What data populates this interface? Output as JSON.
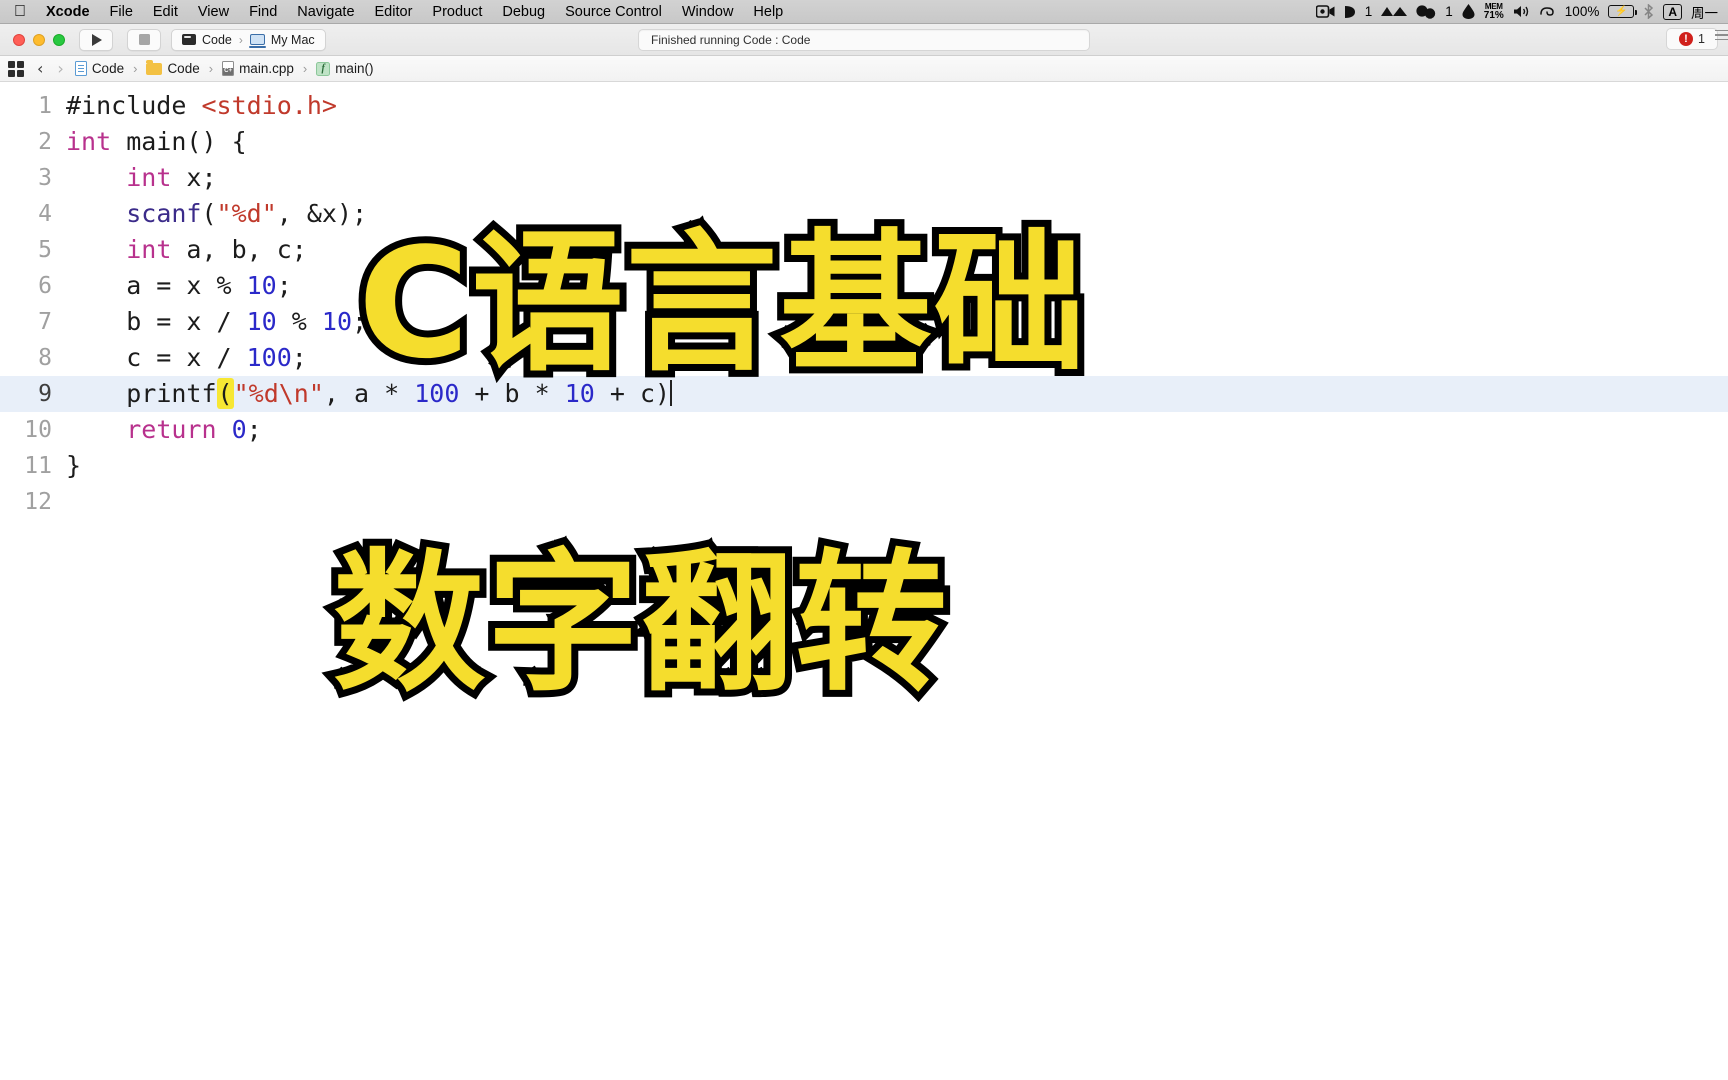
{
  "menubar": {
    "apple_icon": "apple-logo",
    "items": [
      {
        "label": "Xcode",
        "bold": true
      },
      {
        "label": "File",
        "bold": false
      },
      {
        "label": "Edit",
        "bold": false
      },
      {
        "label": "View",
        "bold": false
      },
      {
        "label": "Find",
        "bold": false
      },
      {
        "label": "Navigate",
        "bold": false
      },
      {
        "label": "Editor",
        "bold": false
      },
      {
        "label": "Product",
        "bold": false
      },
      {
        "label": "Debug",
        "bold": false
      },
      {
        "label": "Source Control",
        "bold": false
      },
      {
        "label": "Window",
        "bold": false
      },
      {
        "label": "Help",
        "bold": false
      }
    ],
    "status_icons": {
      "screen_record": "▣",
      "cleanmymac_count": "1",
      "mountain_icon": "▲▲",
      "bubbles_count": "1",
      "mem_label": "MEM",
      "mem_value": "71%",
      "volume_icon": "speaker-icon",
      "control_center_icon": "control-center-icon",
      "battery_percent": "100%",
      "battery_charging": true,
      "bluetooth_icon": "bluetooth-icon",
      "input_source": "A",
      "date_text": "周一"
    }
  },
  "toolbar": {
    "run_button": "run-button",
    "stop_button": "stop-button",
    "scheme_name": "Code",
    "destination_name": "My Mac",
    "status_text": "Finished running Code : Code",
    "error_glyph": "!",
    "issue_count": "1"
  },
  "jumpbar": {
    "crumbs": [
      {
        "label": "Code",
        "icon": "project-icon"
      },
      {
        "label": "Code",
        "icon": "folder-icon"
      },
      {
        "label": "main.cpp",
        "icon": "cpp-file-icon"
      },
      {
        "label": "main()",
        "icon": "function-icon"
      }
    ],
    "back_arrow": "‹",
    "forward_arrow": "›"
  },
  "editor": {
    "active_line": 9,
    "lines": [
      {
        "n": "1",
        "tokens": [
          {
            "t": "#include ",
            "c": "tk-pre"
          },
          {
            "t": "<stdio.h>",
            "c": "tk-hdr"
          }
        ]
      },
      {
        "n": "2",
        "tokens": [
          {
            "t": "int",
            "c": "tk-kw"
          },
          {
            "t": " main() {",
            "c": "tk-plain"
          }
        ]
      },
      {
        "n": "3",
        "tokens": [
          {
            "t": "    ",
            "c": "tk-plain"
          },
          {
            "t": "int",
            "c": "tk-kw"
          },
          {
            "t": " x;",
            "c": "tk-plain"
          }
        ]
      },
      {
        "n": "4",
        "tokens": [
          {
            "t": "    ",
            "c": "tk-plain"
          },
          {
            "t": "scanf",
            "c": "tk-fn"
          },
          {
            "t": "(",
            "c": "tk-plain"
          },
          {
            "t": "\"%d\"",
            "c": "tk-str"
          },
          {
            "t": ", &x);",
            "c": "tk-plain"
          }
        ]
      },
      {
        "n": "5",
        "tokens": [
          {
            "t": "    ",
            "c": "tk-plain"
          },
          {
            "t": "int",
            "c": "tk-kw"
          },
          {
            "t": " a, b, c;",
            "c": "tk-plain"
          }
        ]
      },
      {
        "n": "6",
        "tokens": [
          {
            "t": "    a = x % ",
            "c": "tk-plain"
          },
          {
            "t": "10",
            "c": "tk-num"
          },
          {
            "t": ";",
            "c": "tk-plain"
          }
        ]
      },
      {
        "n": "7",
        "tokens": [
          {
            "t": "    b = x / ",
            "c": "tk-plain"
          },
          {
            "t": "10",
            "c": "tk-num"
          },
          {
            "t": " % ",
            "c": "tk-plain"
          },
          {
            "t": "10",
            "c": "tk-num"
          },
          {
            "t": ";",
            "c": "tk-plain"
          }
        ]
      },
      {
        "n": "8",
        "tokens": [
          {
            "t": "    c = x / ",
            "c": "tk-plain"
          },
          {
            "t": "100",
            "c": "tk-num"
          },
          {
            "t": ";",
            "c": "tk-plain"
          }
        ]
      },
      {
        "n": "9",
        "tokens": [
          {
            "t": "    ",
            "c": "tk-plain"
          },
          {
            "t": "printf",
            "c": "tk-plain"
          },
          {
            "t": "(",
            "c": "hl-paren"
          },
          {
            "t": "\"%d\\n\"",
            "c": "tk-str"
          },
          {
            "t": ", a * ",
            "c": "tk-plain"
          },
          {
            "t": "100",
            "c": "tk-num"
          },
          {
            "t": " + b * ",
            "c": "tk-plain"
          },
          {
            "t": "10",
            "c": "tk-num"
          },
          {
            "t": " + c)",
            "c": "tk-plain"
          }
        ],
        "caret": true
      },
      {
        "n": "10",
        "tokens": [
          {
            "t": "    ",
            "c": "tk-plain"
          },
          {
            "t": "return",
            "c": "tk-kw"
          },
          {
            "t": " ",
            "c": "tk-plain"
          },
          {
            "t": "0",
            "c": "tk-num"
          },
          {
            "t": ";",
            "c": "tk-plain"
          }
        ]
      },
      {
        "n": "11",
        "tokens": [
          {
            "t": "}",
            "c": "tk-plain"
          }
        ]
      },
      {
        "n": "12",
        "tokens": [
          {
            "t": "",
            "c": "tk-plain"
          }
        ]
      }
    ]
  },
  "overlays": {
    "line1": "C语言基础",
    "line2": "数字翻转",
    "fill_color": "#f5dd2d",
    "stroke_color": "#000000"
  }
}
